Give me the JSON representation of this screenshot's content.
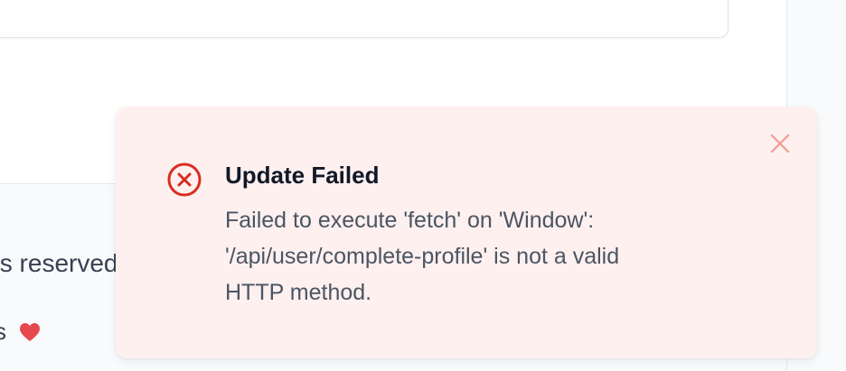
{
  "page": {
    "accent_color": "#d92d20",
    "footer": {
      "copyright_text": "ts reserved.",
      "made_with_text": "s",
      "heart_icon": "heart-icon"
    }
  },
  "toast": {
    "type": "error",
    "icon": "x-circle-icon",
    "title": "Update Failed",
    "message_lines": [
      "Failed to execute 'fetch' on 'Window':",
      "'/api/user/complete-profile' is not a valid",
      "HTTP method."
    ],
    "close_icon": "close-icon"
  }
}
